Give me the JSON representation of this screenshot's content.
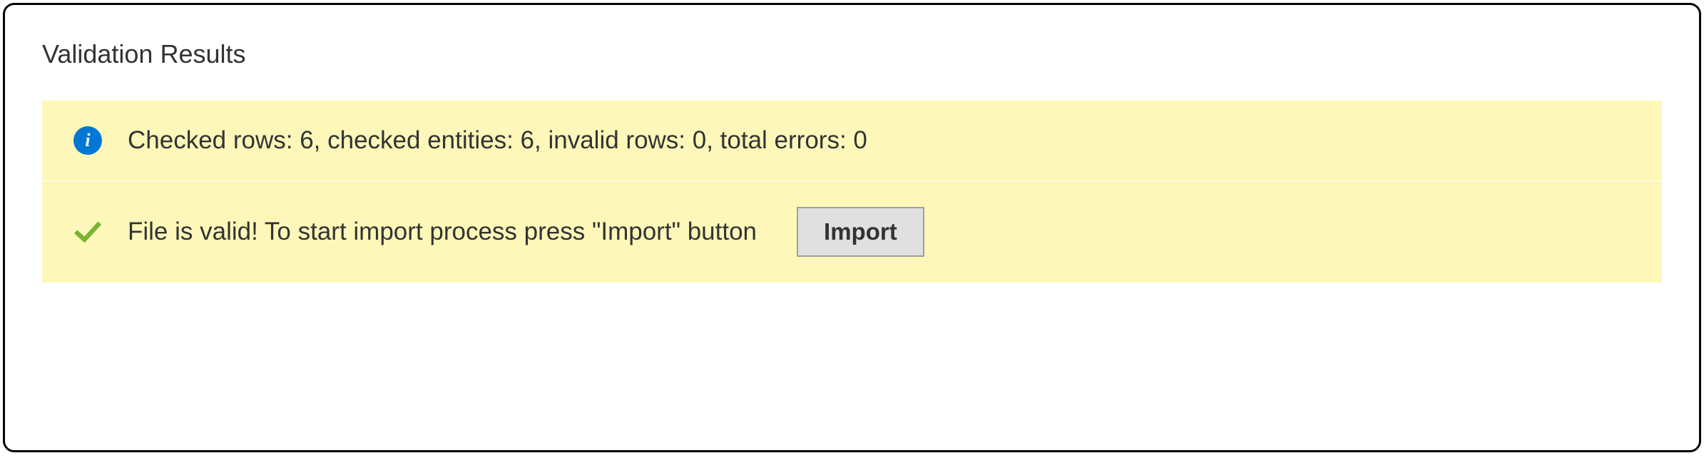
{
  "panel": {
    "title": "Validation Results"
  },
  "messages": {
    "info": "Checked rows: 6, checked entities: 6, invalid rows: 0, total errors: 0",
    "success": "File is valid! To start import process press \"Import\" button"
  },
  "buttons": {
    "import": "Import"
  }
}
